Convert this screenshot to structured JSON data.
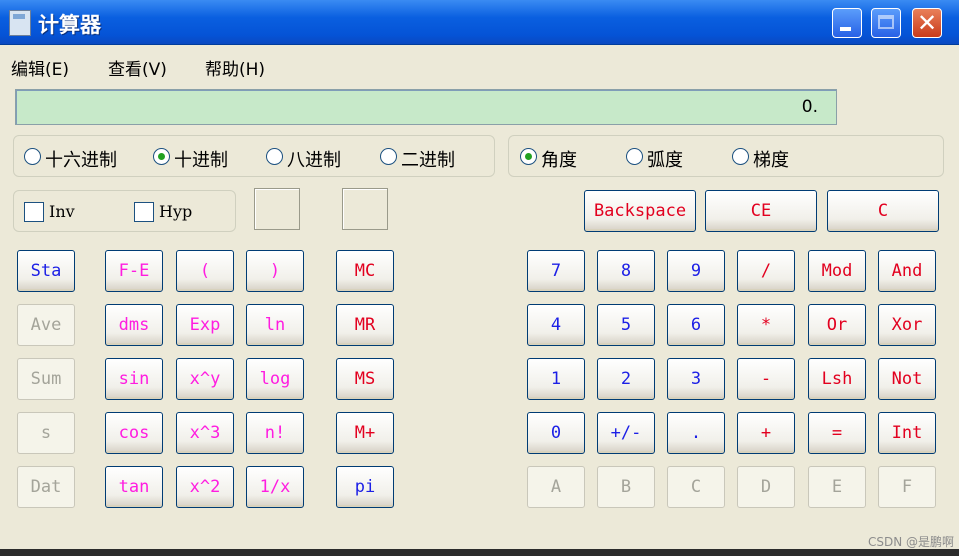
{
  "window": {
    "title": "计算器"
  },
  "menu": [
    "编辑(E)",
    "查看(V)",
    "帮助(H)"
  ],
  "display": {
    "value": "0."
  },
  "number_system": {
    "options": [
      "十六进制",
      "十进制",
      "八进制",
      "二进制"
    ],
    "selected": "十进制"
  },
  "angle_mode": {
    "options": [
      "角度",
      "弧度",
      "梯度"
    ],
    "selected": "角度"
  },
  "checkboxes": {
    "inv": "Inv",
    "hyp": "Hyp"
  },
  "edit_keys": {
    "backspace": "Backspace",
    "ce": "CE",
    "c": "C"
  },
  "stat_keys": [
    "Sta",
    "Ave",
    "Sum",
    "s",
    "Dat"
  ],
  "func_keys": {
    "row1": [
      "F-E",
      "(",
      ")"
    ],
    "row2": [
      "dms",
      "Exp",
      "ln"
    ],
    "row3": [
      "sin",
      "x^y",
      "log"
    ],
    "row4": [
      "cos",
      "x^3",
      "n!"
    ],
    "row5": [
      "tan",
      "x^2",
      "1/x"
    ]
  },
  "memory_keys": [
    "MC",
    "MR",
    "MS",
    "M+",
    "pi"
  ],
  "keypad": {
    "row1": [
      "7",
      "8",
      "9",
      "/",
      "Mod",
      "And"
    ],
    "row2": [
      "4",
      "5",
      "6",
      "*",
      "Or",
      "Xor"
    ],
    "row3": [
      "1",
      "2",
      "3",
      "-",
      "Lsh",
      "Not"
    ],
    "row4": [
      "0",
      "+/-",
      ".",
      "+",
      "=",
      "Int"
    ],
    "row5": [
      "A",
      "B",
      "C",
      "D",
      "E",
      "F"
    ]
  },
  "watermark": "CSDN @是鹏啊",
  "colors": {
    "title_bar": "#0a5fe0",
    "display_bg": "#c7e9c9",
    "digit": "#1c1fe6",
    "operator": "#e2001f",
    "function": "#ff1ce0",
    "disabled": "#a4a49a"
  }
}
